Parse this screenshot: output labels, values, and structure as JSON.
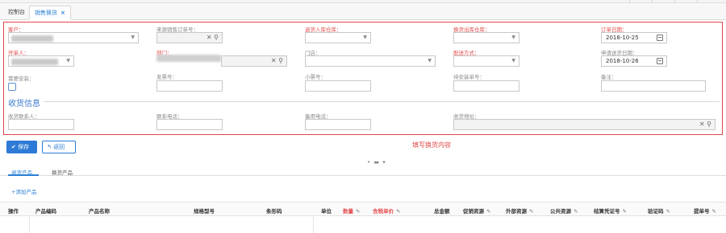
{
  "tabs": [
    {
      "label": "控制台"
    },
    {
      "label": "销售换货",
      "close": "×"
    }
  ],
  "form": {
    "customer": {
      "label": "客户："
    },
    "source_order": {
      "label": "来源销售订单号："
    },
    "return_warehouse": {
      "label": "退货入库仓库："
    },
    "exchange_warehouse": {
      "label": "换货出库仓库："
    },
    "order_date": {
      "label": "订单日期：",
      "value": "2018-10-25"
    },
    "creator": {
      "label": "开单人："
    },
    "department": {
      "label": "部门："
    },
    "store": {
      "label": "门店："
    },
    "delivery_method": {
      "label": "配送方式："
    },
    "apply_delivery_date": {
      "label": "申请送货日期：",
      "value": "2018-10-26"
    },
    "need_install": {
      "label": "需要安装："
    },
    "invoice_no": {
      "label": "发票号："
    },
    "ticket_no": {
      "label": "小票号："
    },
    "install_ticket_no": {
      "label": "待安装单号："
    },
    "remark": {
      "label": "备注："
    }
  },
  "receipt": {
    "title": "收货信息",
    "contact": {
      "label": "收货联系人："
    },
    "phone": {
      "label": "联系电话："
    },
    "backup_phone": {
      "label": "备用电话："
    },
    "address": {
      "label": "收货地址："
    }
  },
  "buttons": {
    "save": "保存",
    "back": "返回"
  },
  "annotation": "填写换货内容",
  "subtabs": [
    "退货产品",
    "换货产品"
  ],
  "add_product": "+添加产品",
  "table": {
    "columns": [
      {
        "label": "操作"
      },
      {
        "label": "产品编码"
      },
      {
        "label": "产品名称"
      },
      {
        "label": "规格型号"
      },
      {
        "label": "条形码"
      },
      {
        "label": "单位"
      },
      {
        "label": "数量"
      },
      {
        "label": "含税单价"
      },
      {
        "label": "总金额"
      },
      {
        "label": "促销资源"
      },
      {
        "label": "外部资源"
      },
      {
        "label": "公共资源"
      },
      {
        "label": "结算凭证号"
      },
      {
        "label": "验证码"
      },
      {
        "label": "提单号"
      }
    ]
  }
}
